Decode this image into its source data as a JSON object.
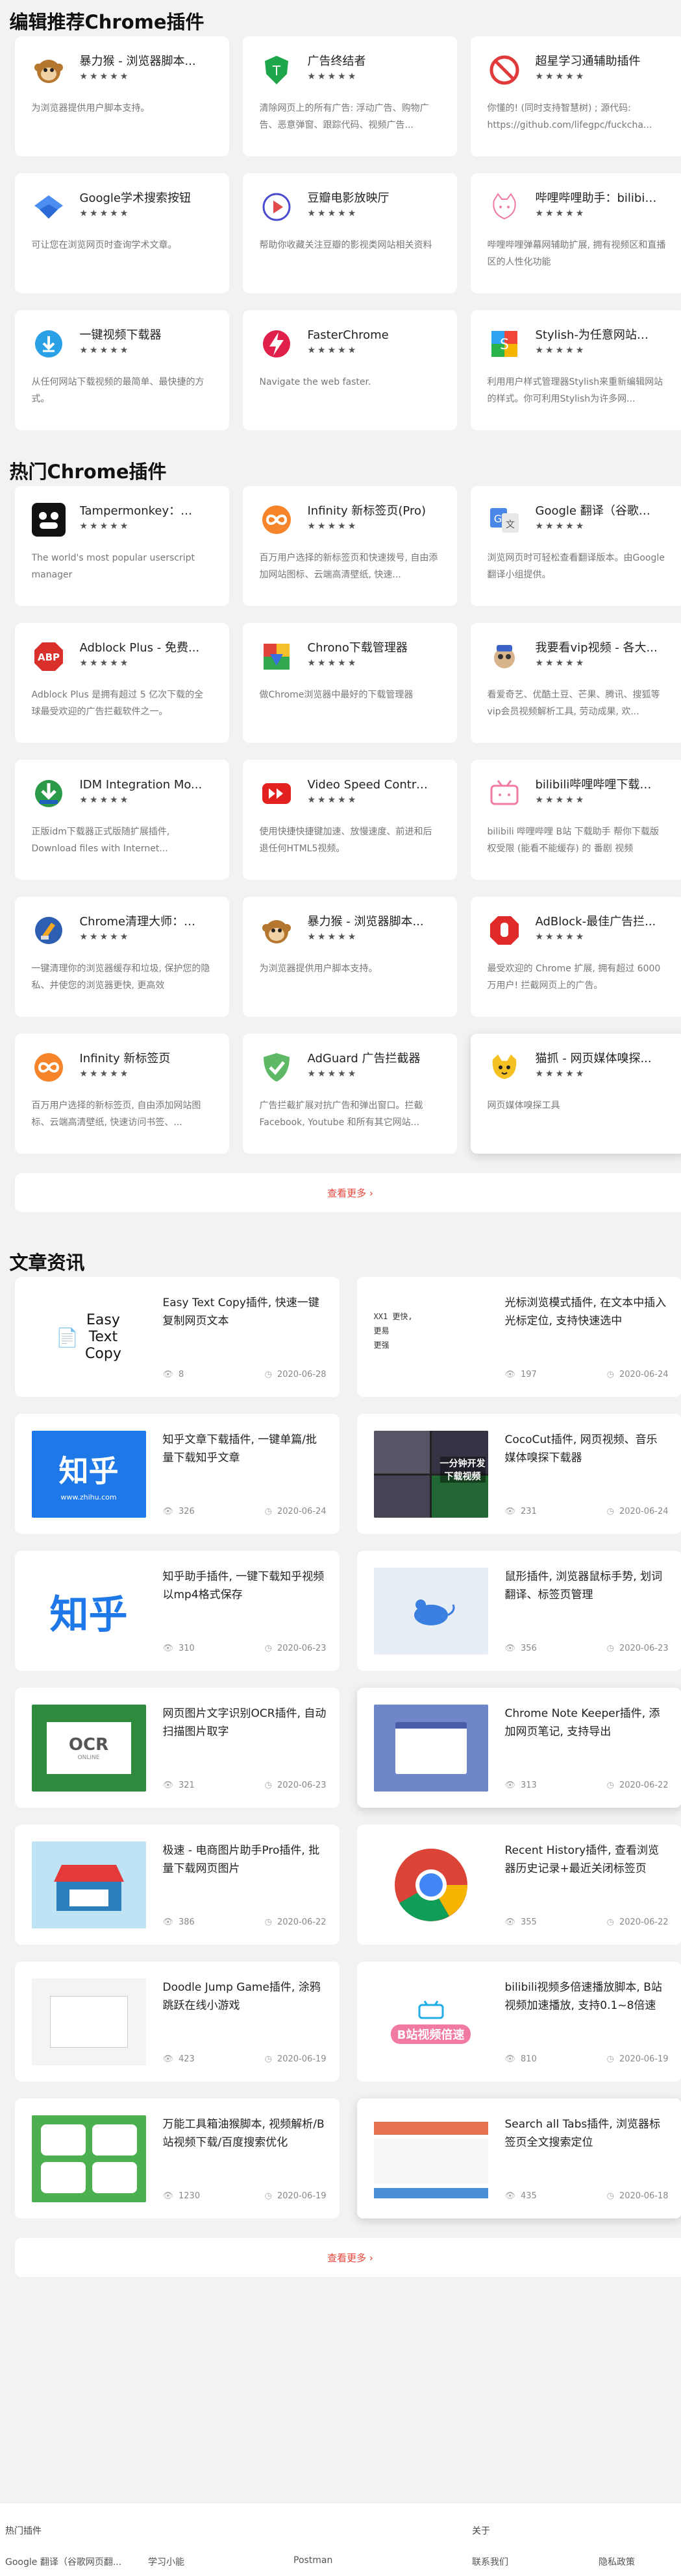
{
  "sections": {
    "editor_title": "编辑推荐Chrome插件",
    "hot_title": "热门Chrome插件",
    "articles_title": "文章资讯"
  },
  "editor_picks": [
    {
      "name": "暴力猴 - 浏览器脚本...",
      "stars": "★★★★★",
      "desc": "为浏览器提供用户脚本支持。",
      "icon": "monkey-icon"
    },
    {
      "name": "广告终结者",
      "stars": "★★★★★",
      "desc": "清除网页上的所有广告: 浮动广告、购物广告、恶意弹窗、跟踪代码、视频广告...",
      "icon": "adterminator-icon"
    },
    {
      "name": "超星学习通辅助插件",
      "stars": "★★★★★",
      "desc": "你懂的! (同时支持智慧树) ; 源代码: https://github.com/lifegpc/fuckcha...",
      "icon": "no-entry-icon"
    },
    {
      "name": "Google学术搜索按钮",
      "stars": "★★★★★",
      "desc": "可让您在浏览网页时查询学术文章。",
      "icon": "scholar-icon"
    },
    {
      "name": "豆瓣电影放映厅",
      "stars": "★★★★★",
      "desc": "帮助你收藏关注豆瓣的影视类网站相关资料",
      "icon": "play-icon"
    },
    {
      "name": "哔哩哔哩助手：bilibili...",
      "stars": "★★★★★",
      "desc": "哔哩哔哩弹幕网辅助扩展, 拥有视频区和直播区的人性化功能",
      "icon": "cat-icon"
    },
    {
      "name": "一键视频下载器",
      "stars": "★★★★★",
      "desc": "从任何网站下载视频的最简单、最快捷的方式。",
      "icon": "download-icon"
    },
    {
      "name": "FasterChrome",
      "stars": "★★★★★",
      "desc": "Navigate the web faster.",
      "icon": "bolt-icon"
    },
    {
      "name": "Stylish-为任意网站自...",
      "stars": "★★★★★",
      "desc": "利用用户样式管理器Stylish来重新编辑网站的样式。你可利用Stylish为许多网...",
      "icon": "stylish-icon"
    }
  ],
  "hot_plugins": [
    {
      "name": "Tampermonkey：用...",
      "stars": "★★★★★",
      "desc": "The world's most popular userscript manager",
      "icon": "tampermonkey-icon"
    },
    {
      "name": "Infinity 新标签页(Pro)",
      "stars": "★★★★★",
      "desc": "百万用户选择的新标签页和快速拨号, 自由添加网站图标、云端高清壁纸, 快速...",
      "icon": "infinity-icon"
    },
    {
      "name": "Google 翻译（谷歌网...",
      "stars": "★★★★★",
      "desc": "浏览网页时可轻松查看翻译版本。由Google翻译小组提供。",
      "icon": "translate-icon"
    },
    {
      "name": "Adblock Plus - 免费...",
      "stars": "★★★★★",
      "desc": "Adblock Plus 是拥有超过 5 亿次下载的全球最受欢迎的广告拦截软件之一。",
      "icon": "abp-icon"
    },
    {
      "name": "Chrono下载管理器",
      "stars": "★★★★★",
      "desc": "做Chrome浏览器中最好的下载管理器",
      "icon": "chrono-icon"
    },
    {
      "name": "我要看vip视频 - 各大...",
      "stars": "★★★★★",
      "desc": "看爱奇艺、优酷土豆、芒果、腾讯、搜狐等vip会员视频解析工具, 劳动成果, 欢...",
      "icon": "vip-icon"
    },
    {
      "name": "IDM Integration Mo...",
      "stars": "★★★★★",
      "desc": "正版idm下载器正式版随扩展插件, Download files with Internet...",
      "icon": "idm-icon"
    },
    {
      "name": "Video Speed Contro...",
      "stars": "★★★★★",
      "desc": "使用快捷快捷键加速、放慢速度、前进和后退任何HTML5视频。",
      "icon": "fastforward-icon"
    },
    {
      "name": "bilibili哔哩哔哩下载助...",
      "stars": "★★★★★",
      "desc": "bilibili 哔哩哔哩 B站 下载助手 帮你下载版权受限 (能看不能缓存) 的 番剧 视频",
      "icon": "bilibili-tv-icon"
    },
    {
      "name": "Chrome清理大师：一...",
      "stars": "★★★★★",
      "desc": "一键清理你的浏览器缓存和垃圾, 保护您的隐私、并使您的浏览器更快, 更高效",
      "icon": "cleaner-icon"
    },
    {
      "name": "暴力猴 - 浏览器脚本...",
      "stars": "★★★★★",
      "desc": "为浏览器提供用户脚本支持。",
      "icon": "monkey-icon"
    },
    {
      "name": "AdBlock-最佳广告拦...",
      "stars": "★★★★★",
      "desc": "最受欢迎的 Chrome 扩展, 拥有超过 6000 万用户! 拦截网页上的广告。",
      "icon": "adblock-icon"
    },
    {
      "name": "Infinity 新标签页",
      "stars": "★★★★★",
      "desc": "百万用户选择的新标签页, 自由添加网站图标、云端高清壁纸, 快速访问书签、...",
      "icon": "infinity-icon"
    },
    {
      "name": "AdGuard 广告拦截器",
      "stars": "★★★★★",
      "desc": "广告拦截扩展对抗广告和弹出窗口。拦截Facebook, Youtube 和所有其它网站...",
      "icon": "adguard-icon"
    },
    {
      "name": "猫抓 - 网页媒体嗅探...",
      "stars": "★★★★★",
      "desc": "网页媒体嗅探工具",
      "icon": "cat-catch-icon"
    }
  ],
  "more_label": "查看更多 ›",
  "articles": [
    {
      "title": "Easy Text Copy插件, 快速一键复制网页文本",
      "views": "8",
      "date": "2020-06-28",
      "thumb": "easy-text-copy",
      "thumb_text": "Easy\nText\nCopy"
    },
    {
      "title": "光标浏览模式插件, 在文本中插入光标定位, 支持快速选中",
      "views": "197",
      "date": "2020-06-24",
      "thumb": "caret",
      "thumb_text": "XX1 更快,\n更易\n更强"
    },
    {
      "title": "知乎文章下载插件, 一键单篇/批量下载知乎文章",
      "views": "326",
      "date": "2020-06-24",
      "thumb": "zhihu-blue",
      "thumb_text": "知乎",
      "thumb_sub": "www.zhihu.com"
    },
    {
      "title": "CocoCut插件, 网页视频、音乐媒体嗅探下载器",
      "views": "231",
      "date": "2020-06-24",
      "thumb": "cococut",
      "thumb_text": "一分钟开发\n下载视频"
    },
    {
      "title": "知乎助手插件, 一键下载知乎视频以mp4格式保存",
      "views": "310",
      "date": "2020-06-23",
      "thumb": "zhihu-white",
      "thumb_text": "知乎"
    },
    {
      "title": "鼠形插件, 浏览器鼠标手势, 划词翻译、标签页管理",
      "views": "356",
      "date": "2020-06-23",
      "thumb": "mouse",
      "thumb_text": ""
    },
    {
      "title": "网页图片文字识别OCR插件, 自动扫描图片取字",
      "views": "321",
      "date": "2020-06-23",
      "thumb": "ocr",
      "thumb_text": "OCR",
      "thumb_sub": "ONLINE"
    },
    {
      "title": "Chrome Note Keeper插件, 添加网页笔记, 支持导出",
      "views": "313",
      "date": "2020-06-22",
      "thumb": "note-keeper",
      "thumb_text": ""
    },
    {
      "title": "极速 - 电商图片助手Pro插件, 批量下载网页图片",
      "views": "386",
      "date": "2020-06-22",
      "thumb": "shop",
      "thumb_text": ""
    },
    {
      "title": "Recent History插件, 查看浏览器历史记录+最近关闭标签页",
      "views": "355",
      "date": "2020-06-22",
      "thumb": "chrome",
      "thumb_text": ""
    },
    {
      "title": "Doodle Jump Game插件, 涂鸦跳跃在线小游戏",
      "views": "423",
      "date": "2020-06-19",
      "thumb": "doodle",
      "thumb_text": ""
    },
    {
      "title": "bilibili视频多倍速播放脚本, B站视频加速播放, 支持0.1~8倍速",
      "views": "810",
      "date": "2020-06-19",
      "thumb": "bili-speed",
      "thumb_text": "B站视频倍速"
    },
    {
      "title": "万能工具箱油猴脚本, 视频解析/B站视频下载/百度搜索优化",
      "views": "1230",
      "date": "2020-06-19",
      "thumb": "toolbox",
      "thumb_text": ""
    },
    {
      "title": "Search all Tabs插件, 浏览器标签页全文搜索定位",
      "views": "435",
      "date": "2020-06-18",
      "thumb": "search-tabs",
      "thumb_text": ""
    }
  ],
  "footer": {
    "col1_title": "热门插件",
    "col2_title": "关于",
    "links": [
      "Google 翻译（谷歌网页翻...",
      "学习小能",
      "Postman",
      "联系我们",
      "隐私政策"
    ]
  },
  "colors": {
    "accent": "#e8443a",
    "page_bg": "#f2f2f2",
    "card_bg": "#ffffff"
  }
}
